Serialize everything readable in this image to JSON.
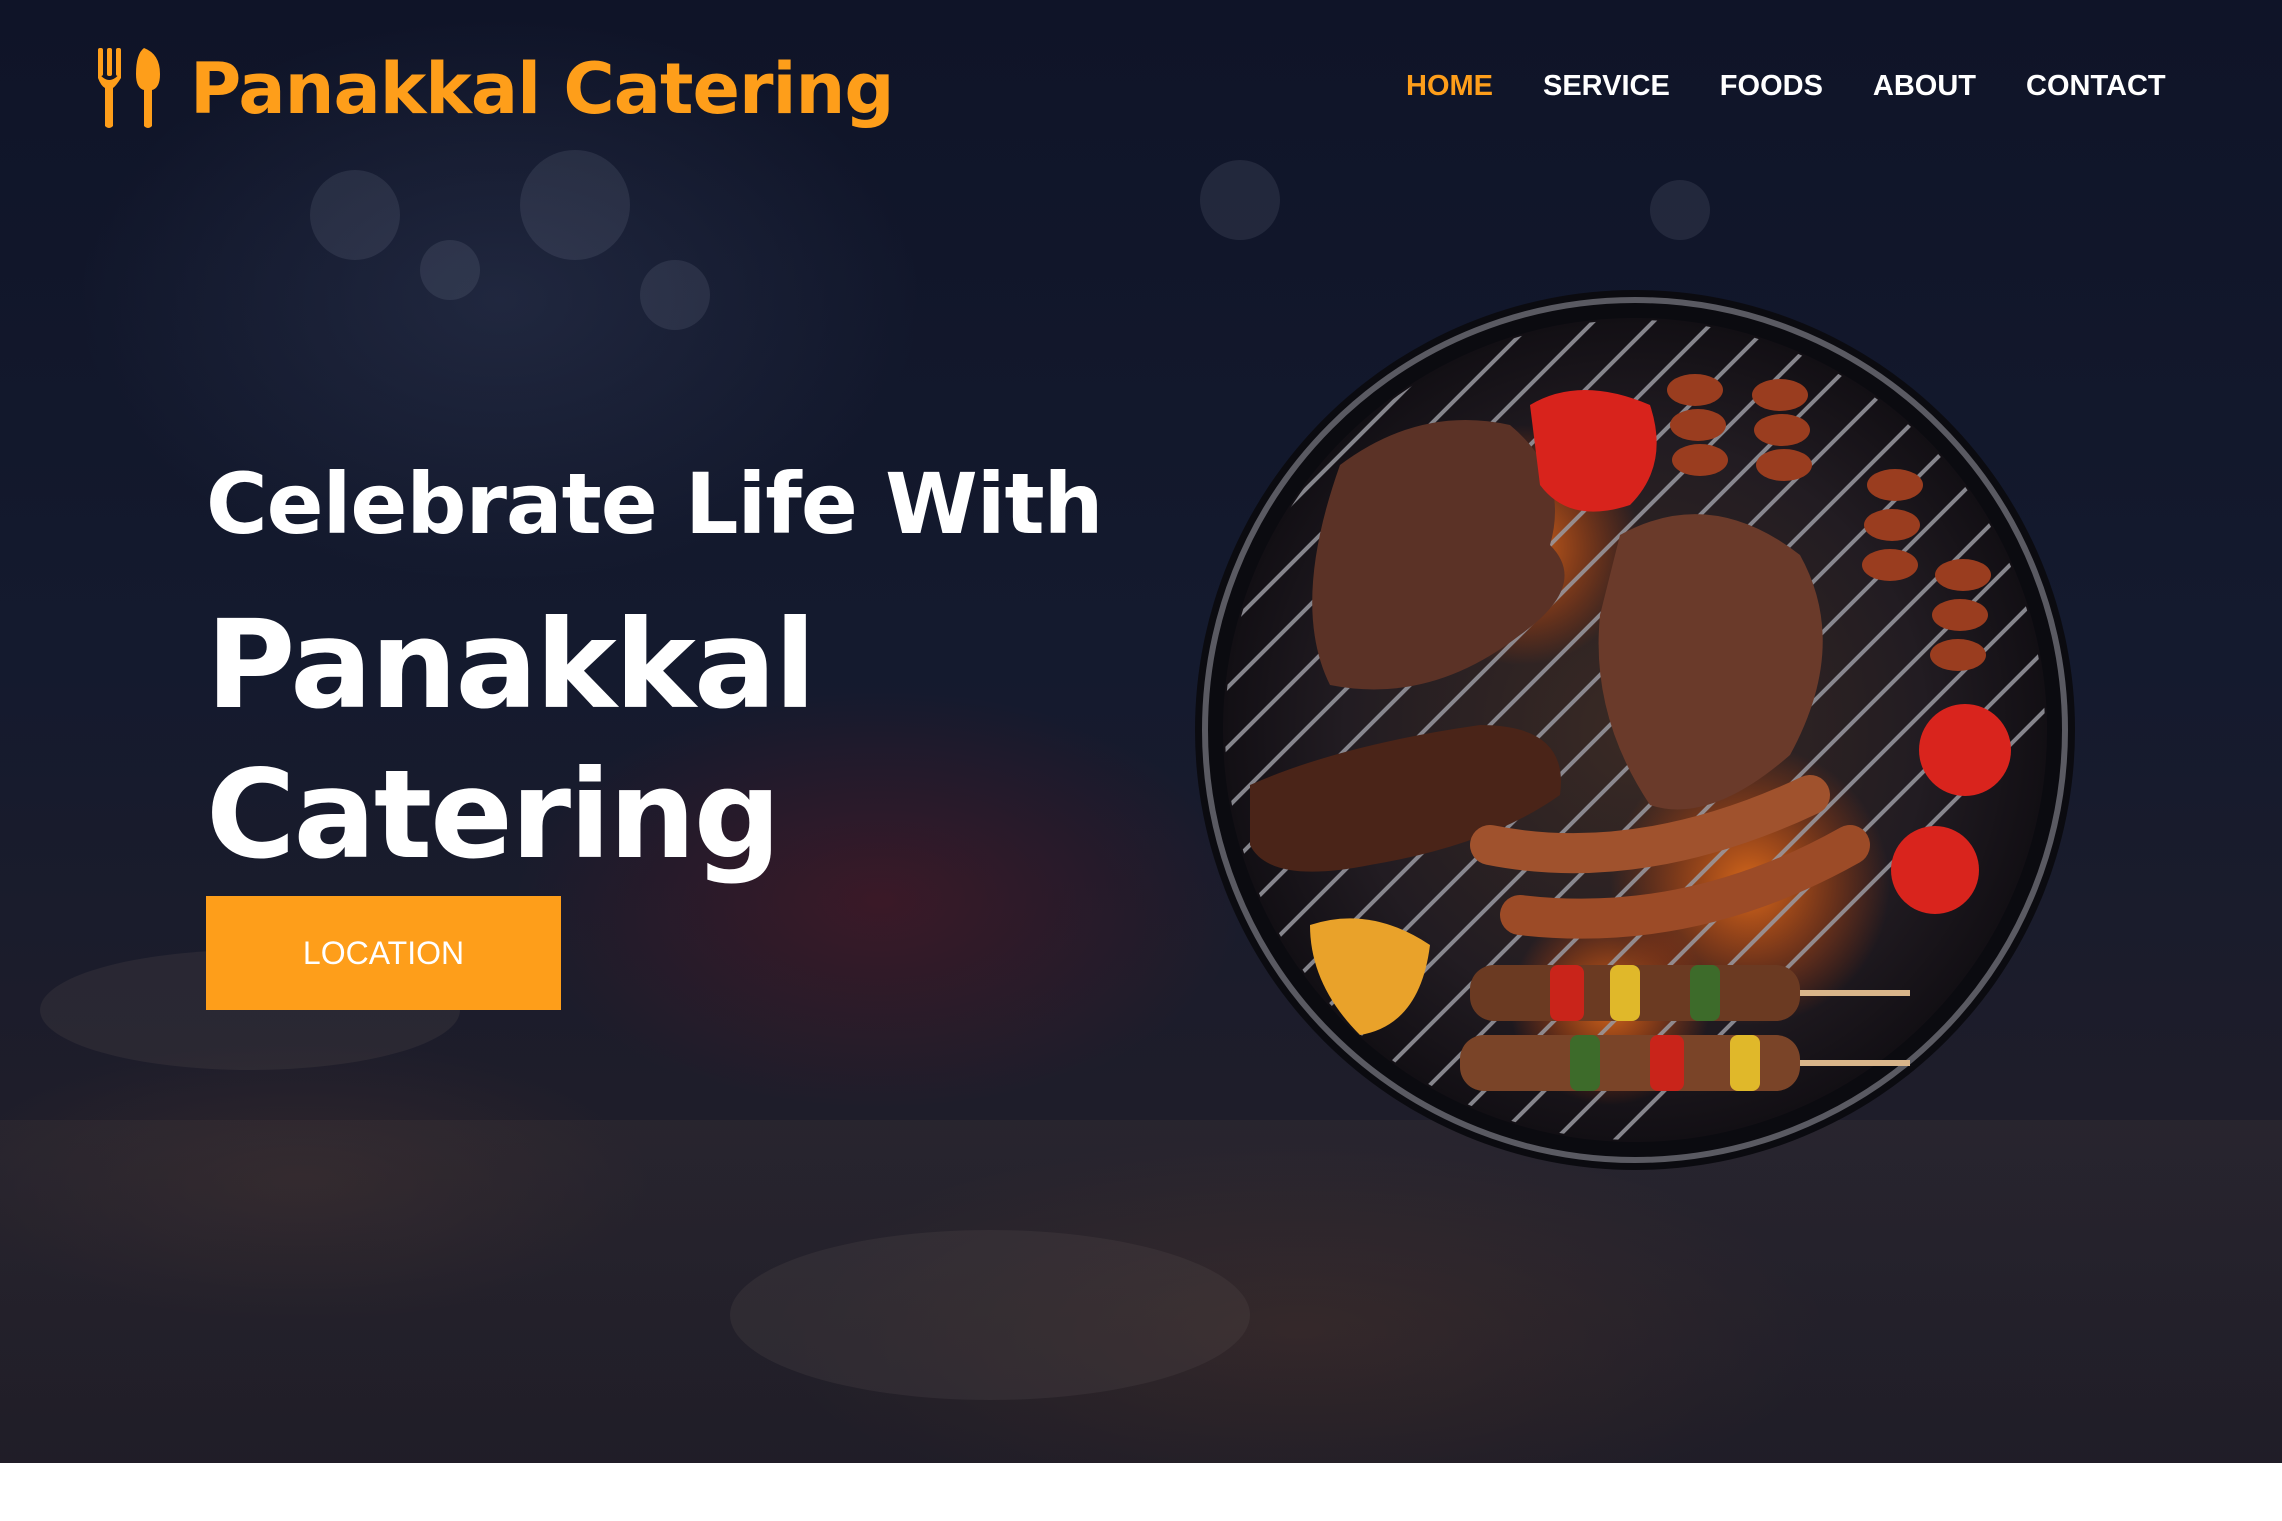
{
  "brand": {
    "name": "Panakkal Catering",
    "accent": "#fe9e1a",
    "background": "#0f1428"
  },
  "nav": {
    "items": [
      {
        "label": "HOME",
        "active": true
      },
      {
        "label": "SERVICE",
        "active": false
      },
      {
        "label": "FOODS",
        "active": false
      },
      {
        "label": "ABOUT",
        "active": false
      },
      {
        "label": "CONTACT",
        "active": false
      }
    ]
  },
  "hero": {
    "tagline": "Celebrate Life With",
    "title": "Panakkal Catering",
    "button_label": "LOCATION",
    "image": "bbq-grill-platter"
  },
  "icons": {
    "logo": "fork-spoon-icon"
  }
}
